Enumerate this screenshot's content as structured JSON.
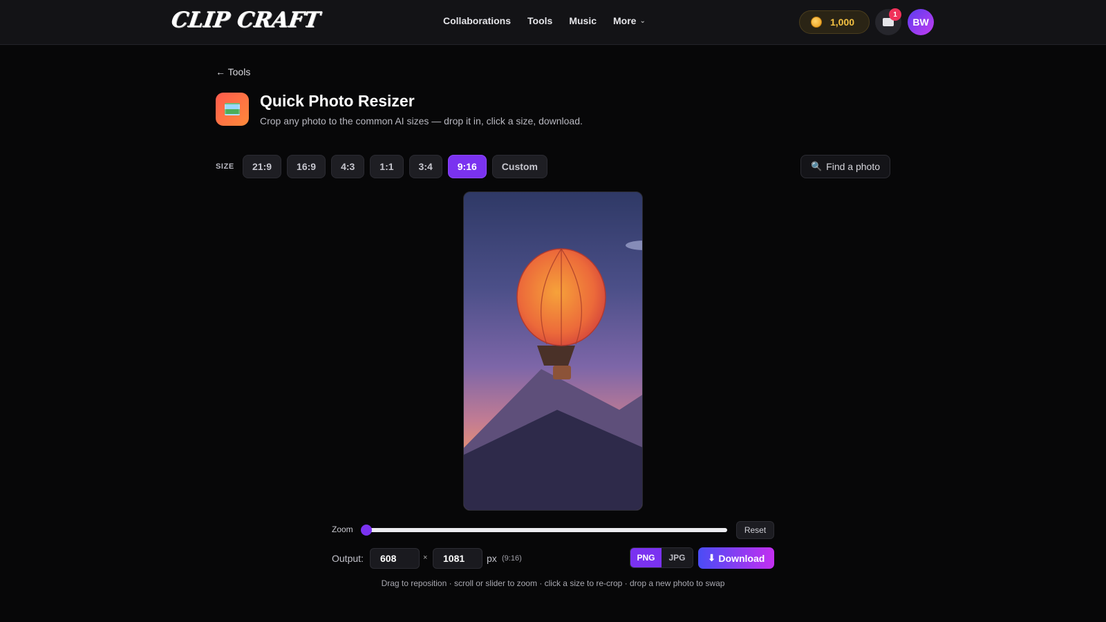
{
  "header": {
    "logo": "CLIP CRAFT",
    "nav": [
      "Collaborations",
      "Tools",
      "Music",
      "More"
    ],
    "coins": "1,000",
    "notifications": "1",
    "avatar": "BW"
  },
  "page": {
    "back": "← Tools",
    "title": "Quick Photo Resizer",
    "subtitle": "Crop any photo to the common AI sizes — drop it in, click a size, download."
  },
  "size": {
    "label": "SIZE",
    "options": [
      "21:9",
      "16:9",
      "4:3",
      "1:1",
      "3:4",
      "9:16",
      "Custom"
    ],
    "selected": "9:16",
    "find_label": "Find a photo"
  },
  "zoom": {
    "label": "Zoom",
    "value": 0,
    "reset_label": "Reset"
  },
  "output": {
    "label": "Output:",
    "width": "608",
    "height": "1081",
    "times": "×",
    "unit": "px",
    "ratio": "(9:16)",
    "formats": [
      "PNG",
      "JPG"
    ],
    "selected_format": "PNG",
    "download_label": "Download"
  },
  "hint": "Drag to reposition · scroll or slider to zoom · click a size to re-crop · drop a new photo to swap",
  "icons": {
    "coin": "coin-icon",
    "messages": "envelope-icon",
    "find": "search-icon",
    "download": "download-arrow-icon",
    "back": "arrow-left-icon",
    "more": "chevron-down-icon",
    "app": "image-icon"
  },
  "colors": {
    "accent": "#7a32f0",
    "background": "#070708",
    "header": "#131316",
    "coin": "#f5c242",
    "badge": "#f0325a"
  }
}
